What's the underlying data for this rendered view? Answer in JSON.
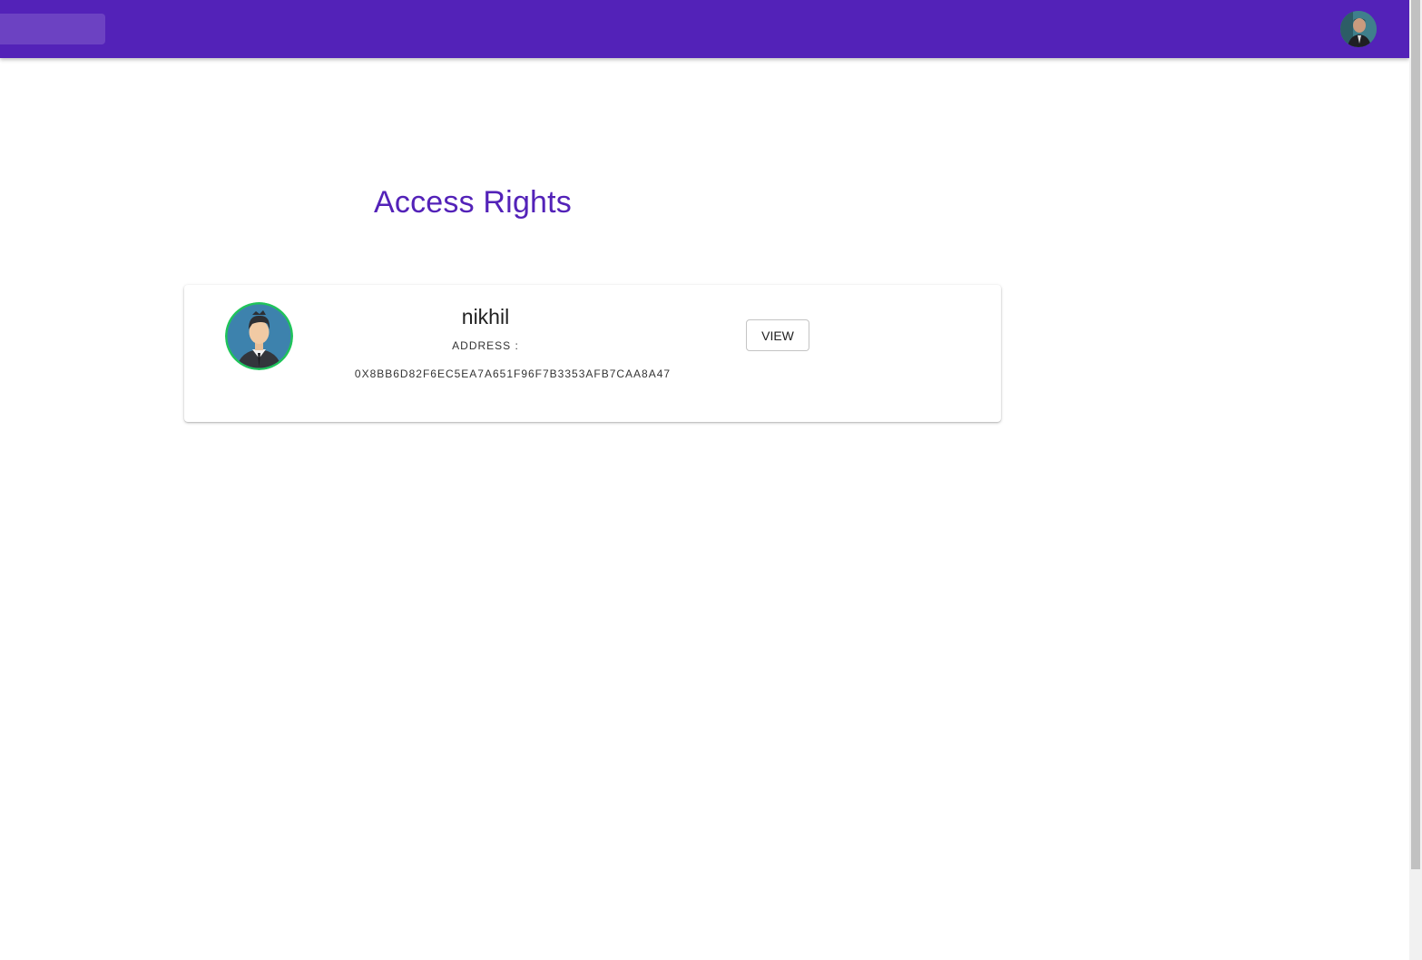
{
  "appbar": {
    "color": "#5322b8",
    "profile_icon": "user-avatar-icon"
  },
  "main": {
    "title": "Access Rights",
    "title_color": "#5322b8"
  },
  "access_list": [
    {
      "name": "nikhil",
      "address_label": "ADDRESS :",
      "address": "0X8BB6D82F6EC5EA7A651F96F7B3353AFB7CAA8A47",
      "view_label": "VIEW",
      "avatar_icon": "user-avatar-icon"
    }
  ]
}
